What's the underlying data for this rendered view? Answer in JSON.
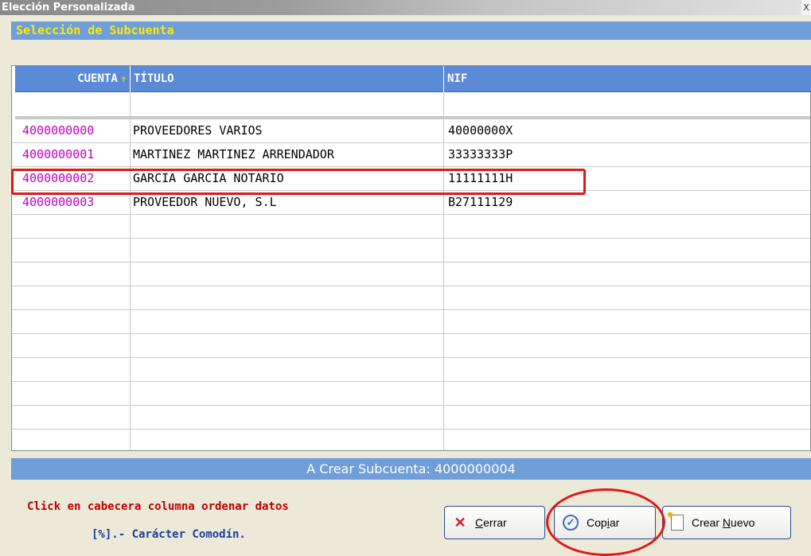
{
  "window": {
    "title": "Elección Personalizada",
    "close_glyph": "X"
  },
  "section_title": "Selección de Subcuenta",
  "grid": {
    "columns": {
      "cuenta": "CUENTA",
      "titulo": "TÍTULO",
      "nif": "NIF"
    },
    "sort_indicator": "ascending-sort-icon",
    "filters": {
      "cuenta": "",
      "titulo": "",
      "nif": ""
    },
    "rows": [
      {
        "cuenta": "4000000000",
        "titulo": "PROVEEDORES VARIOS",
        "nif": "40000000X"
      },
      {
        "cuenta": "4000000001",
        "titulo": "MARTINEZ MARTINEZ ARRENDADOR",
        "nif": "33333333P"
      },
      {
        "cuenta": "4000000002",
        "titulo": "GARCIA GARCIA NOTARIO",
        "nif": "11111111H"
      },
      {
        "cuenta": "4000000003",
        "titulo": "PROVEEDOR NUEVO, S.L",
        "nif": "B27111129"
      }
    ],
    "selected_row_index": 2
  },
  "status": "A Crear Subcuenta: 4000000004",
  "hints": {
    "line1": "Click en cabecera columna ordenar datos",
    "line2": "[%].- Carácter Comodín."
  },
  "buttons": {
    "cerrar": {
      "first": "C",
      "rest": "errar",
      "icon": "close-x-icon"
    },
    "copiar": {
      "pre": "Cop",
      "underlined": "i",
      "post": "ar",
      "icon": "check-circle-icon"
    },
    "crear": {
      "pre": "Crear ",
      "underlined": "N",
      "post": "uevo",
      "icon": "new-document-icon"
    }
  },
  "colors": {
    "accent_blue": "#6f9ed9",
    "header_blue": "#5b8ad6",
    "section_title_yellow": "#ffea00",
    "account_magenta": "#c000c0",
    "annotation_red": "#e01818",
    "hint_red": "#c00000",
    "hint_blue": "#1a3fa0"
  }
}
